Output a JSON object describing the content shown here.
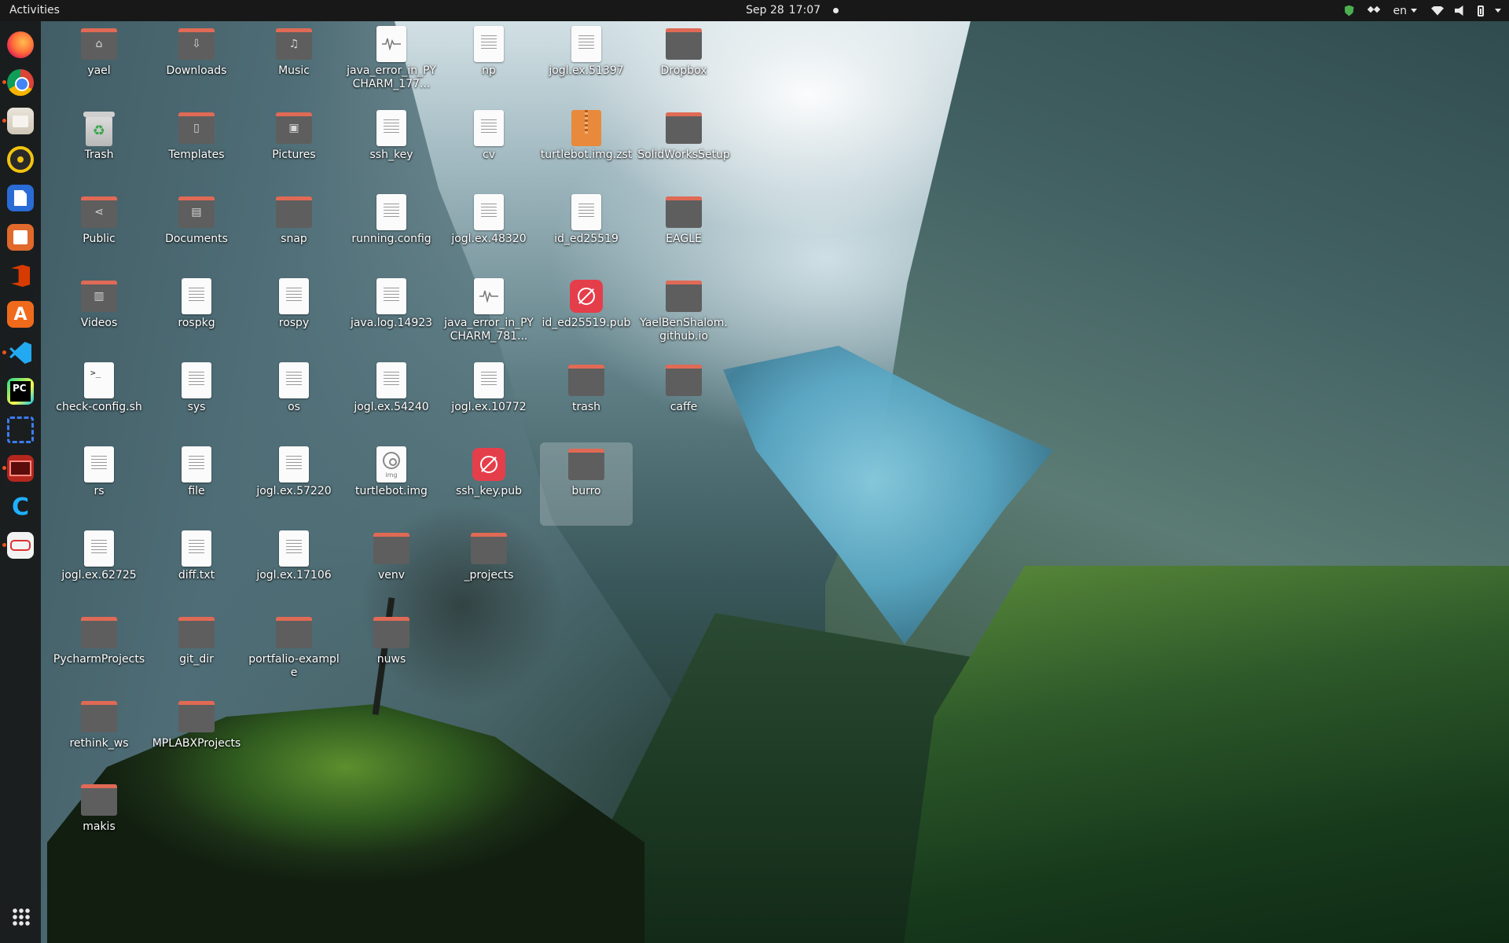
{
  "topbar": {
    "activities": "Activities",
    "date": "Sep 28",
    "time": "17:07",
    "language": "en"
  },
  "dock": {
    "apps": [
      {
        "name": "firefox-icon"
      },
      {
        "name": "chrome-icon"
      },
      {
        "name": "files-icon"
      },
      {
        "name": "rhythmbox-icon"
      },
      {
        "name": "libreoffice-writer-icon"
      },
      {
        "name": "libreoffice-impress-icon"
      },
      {
        "name": "office-icon"
      },
      {
        "name": "software-store-icon"
      },
      {
        "name": "vscode-icon"
      },
      {
        "name": "pycharm-icon",
        "text": "PC"
      },
      {
        "name": "screenshot-icon"
      },
      {
        "name": "red-app-icon"
      },
      {
        "name": "c-app-icon",
        "text": "C"
      },
      {
        "name": "document-viewer-icon"
      }
    ],
    "show_apps": "show-applications-icon"
  },
  "desktop": {
    "icons": [
      {
        "label": "yael",
        "type": "folder",
        "emblem": "⌂"
      },
      {
        "label": "Downloads",
        "type": "folder",
        "emblem": "⇩"
      },
      {
        "label": "Music",
        "type": "folder",
        "emblem": "♫"
      },
      {
        "label": "java_error_in_PYCHARM_177...",
        "type": "wave"
      },
      {
        "label": "np",
        "type": "doc"
      },
      {
        "label": "jogl.ex.51397",
        "type": "doc"
      },
      {
        "label": "Dropbox",
        "type": "folder"
      },
      {
        "label": "Trash",
        "type": "trash"
      },
      {
        "label": "Templates",
        "type": "folder",
        "emblem": "▯"
      },
      {
        "label": "Pictures",
        "type": "folder",
        "emblem": "▣"
      },
      {
        "label": "ssh_key",
        "type": "doc"
      },
      {
        "label": "cv",
        "type": "doc"
      },
      {
        "label": "turtlebot.img.zst",
        "type": "archive"
      },
      {
        "label": "SolidWorksSetup",
        "type": "folder"
      },
      {
        "label": "Public",
        "type": "folder",
        "emblem": "⋖"
      },
      {
        "label": "Documents",
        "type": "folder",
        "emblem": "▤"
      },
      {
        "label": "snap",
        "type": "folder"
      },
      {
        "label": "running.config",
        "type": "doc"
      },
      {
        "label": "jogl.ex.48320",
        "type": "doc"
      },
      {
        "label": "id_ed25519",
        "type": "doc"
      },
      {
        "label": "EAGLE",
        "type": "folder"
      },
      {
        "label": "Videos",
        "type": "folder",
        "emblem": "▥"
      },
      {
        "label": "rospkg",
        "type": "doc"
      },
      {
        "label": "rospy",
        "type": "doc"
      },
      {
        "label": "java.log.14923",
        "type": "doc"
      },
      {
        "label": "java_error_in_PYCHARM_781...",
        "type": "wave"
      },
      {
        "label": "id_ed25519.pub",
        "type": "key"
      },
      {
        "label": "YaelBenShalom.github.io",
        "type": "folder"
      },
      {
        "label": "check-config.sh",
        "type": "term"
      },
      {
        "label": "sys",
        "type": "doc"
      },
      {
        "label": "os",
        "type": "doc"
      },
      {
        "label": "jogl.ex.54240",
        "type": "doc"
      },
      {
        "label": "jogl.ex.10772",
        "type": "doc"
      },
      {
        "label": "trash",
        "type": "folder"
      },
      {
        "label": "caffe",
        "type": "folder"
      },
      {
        "label": "rs",
        "type": "doc"
      },
      {
        "label": "file",
        "type": "doc"
      },
      {
        "label": "jogl.ex.57220",
        "type": "doc"
      },
      {
        "label": "turtlebot.img",
        "type": "disc",
        "sublabel": "img"
      },
      {
        "label": "ssh_key.pub",
        "type": "key"
      },
      {
        "label": "burro",
        "type": "folder",
        "selected": true
      },
      {
        "label": "jogl.ex.62725",
        "type": "doc"
      },
      {
        "label": "diff.txt",
        "type": "doc"
      },
      {
        "label": "jogl.ex.17106",
        "type": "doc"
      },
      {
        "label": "venv",
        "type": "folder"
      },
      {
        "label": "_projects",
        "type": "folder"
      },
      {
        "label": "PycharmProjects",
        "type": "folder"
      },
      {
        "label": "git_dir",
        "type": "folder"
      },
      {
        "label": "portfalio-example",
        "type": "folder"
      },
      {
        "label": "nuws",
        "type": "folder"
      },
      {
        "label": "rethink_ws",
        "type": "folder"
      },
      {
        "label": "MPLABXProjects",
        "type": "folder"
      },
      {
        "label": "makis",
        "type": "folder"
      }
    ]
  }
}
